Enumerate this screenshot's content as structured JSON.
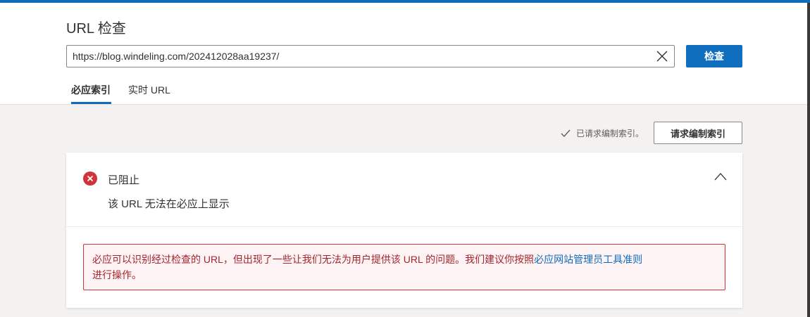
{
  "colors": {
    "accent": "#0f6cbd",
    "error": "#d13438",
    "error_text": "#a4262c",
    "page_bg": "#f3f2f1"
  },
  "header": {
    "title": "URL 检查",
    "url_value": "https://blog.windeling.com/202412028aa19237/",
    "check_label": "检查",
    "tabs": [
      {
        "label": "必应索引",
        "active": true
      },
      {
        "label": "实时 URL",
        "active": false
      }
    ]
  },
  "actions": {
    "requested_text": "已请求编制索引。",
    "request_indexing_label": "请求编制索引"
  },
  "status_card": {
    "status_title": "已阻止",
    "status_description": "该 URL 无法在必应上显示",
    "alert_text": "必应可以识别经过检查的 URL，但出现了一些让我们无法为用户提供该 URL 的问题。我们建议你按照",
    "alert_link": "必应网站管理员工具准则",
    "alert_suffix": "进行操作。",
    "icons": [
      "error-circle-icon",
      "chevron-up-icon",
      "checkmark-icon",
      "close-icon"
    ]
  }
}
